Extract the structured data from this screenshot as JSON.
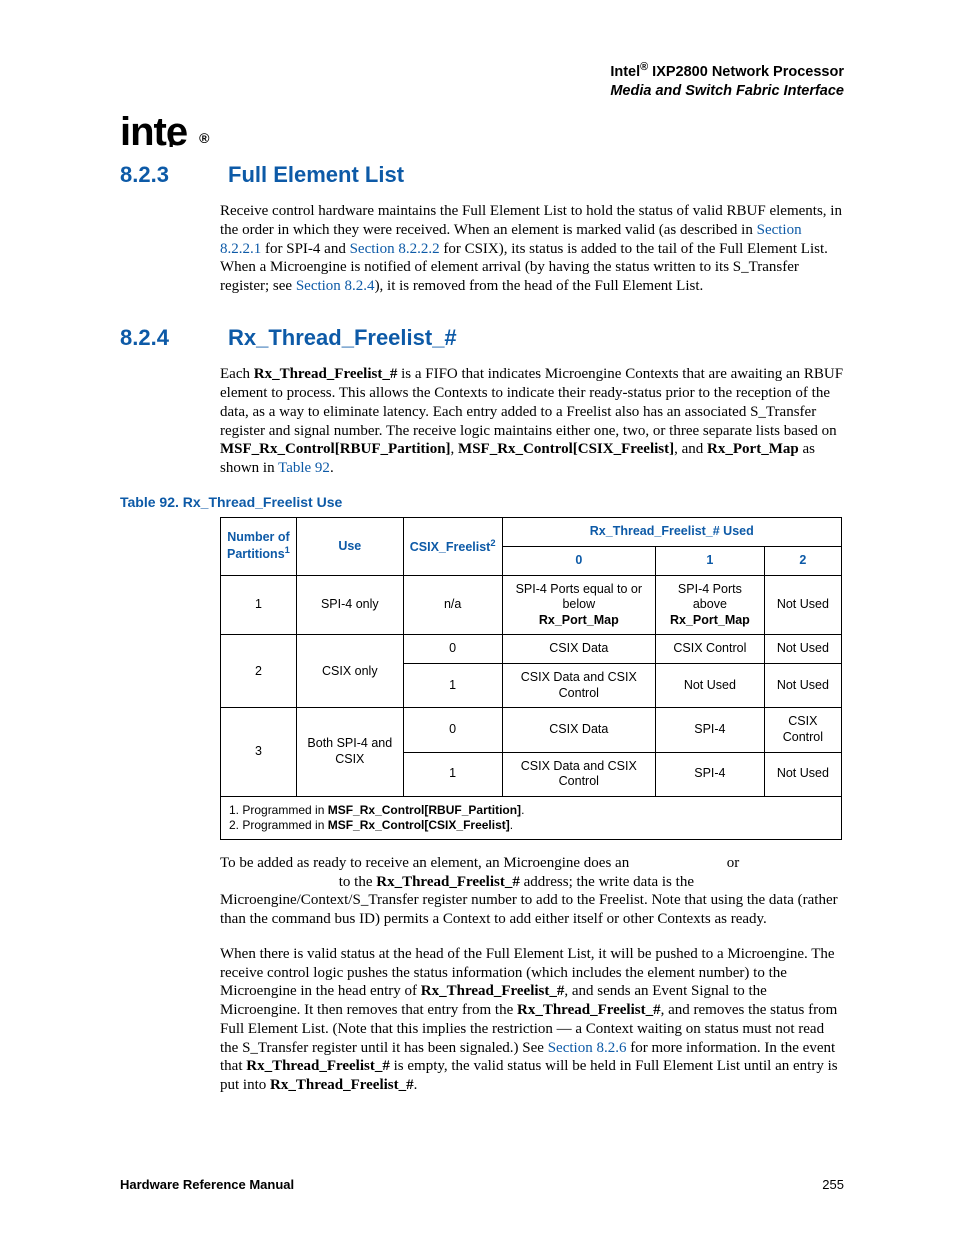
{
  "header": {
    "line1_pre": "Intel",
    "line1_post": " IXP2800 Network Processor",
    "line2": "Media and Switch Fabric Interface"
  },
  "logo": "intel",
  "sections": {
    "s823": {
      "num": "8.2.3",
      "title": "Full Element List"
    },
    "s824": {
      "num": "8.2.4",
      "title": "Rx_Thread_Freelist_#"
    }
  },
  "para823": {
    "t1": "Receive control hardware maintains the Full Element List to hold the status of valid RBUF elements, in the order in which they were received. When an element is marked valid (as described in ",
    "l1": "Section 8.2.2.1",
    "t2": " for SPI-4 and ",
    "l2": "Section 8.2.2.2",
    "t3": " for CSIX), its status is added to the tail of the Full Element List. When a Microengine is notified of element arrival (by having the status written to its S_Transfer register; see ",
    "l3": "Section 8.2.4",
    "t4": "), it is removed from the head of the Full Element List."
  },
  "para824a": {
    "t1": "Each ",
    "b1": "Rx_Thread_Freelist_#",
    "t2": " is a FIFO that indicates Microengine Contexts that are awaiting an RBUF element to process. This allows the Contexts to indicate their ready-status prior to the reception of the data, as a way to eliminate latency. Each entry added to a Freelist also has an associated S_Transfer register and signal number. The receive logic maintains either one, two, or three separate lists based on ",
    "b2": "MSF_Rx_Control[RBUF_Partition]",
    "t3": ", ",
    "b3": "MSF_Rx_Control[CSIX_Freelist]",
    "t4": ", and ",
    "b4": "Rx_Port_Map",
    "t5": " as shown in ",
    "l1": "Table 92",
    "t6": "."
  },
  "table": {
    "caption": "Table 92.  Rx_Thread_Freelist Use",
    "head": {
      "c1a": "Number of",
      "c1b": "Partitions",
      "c2": "Use",
      "c3": "CSIX_Freelist",
      "topspan": "Rx_Thread_Freelist_# Used",
      "s0": "0",
      "s1": "1",
      "s2": "2"
    },
    "rows": {
      "r1": {
        "p": "1",
        "use": "SPI-4 only",
        "cf": "n/a",
        "c0a": "SPI-4 Ports equal to or below",
        "c0b": "Rx_Port_Map",
        "c1a": "SPI-4 Ports above",
        "c1b": "Rx_Port_Map",
        "c2": "Not Used"
      },
      "r2": {
        "p": "2",
        "use": "CSIX only",
        "a": {
          "cf": "0",
          "c0": "CSIX Data",
          "c1": "CSIX Control",
          "c2": "Not Used"
        },
        "b": {
          "cf": "1",
          "c0": "CSIX Data and CSIX Control",
          "c1": "Not Used",
          "c2": "Not Used"
        }
      },
      "r3": {
        "p": "3",
        "use": "Both SPI-4 and CSIX",
        "a": {
          "cf": "0",
          "c0": "CSIX Data",
          "c1": "SPI-4",
          "c2": "CSIX Control"
        },
        "b": {
          "cf": "1",
          "c0": "CSIX Data and CSIX Control",
          "c1": "SPI-4",
          "c2": "Not Used"
        }
      }
    },
    "foot": {
      "f1a": "1. Programmed in ",
      "f1b": "MSF_Rx_Control[RBUF_Partition]",
      "f1c": ".",
      "f2a": "2. Programmed in ",
      "f2b": "MSF_Rx_Control[CSIX_Freelist]",
      "f2c": "."
    }
  },
  "para824b": {
    "t1": "To be added as ready to receive an element, an Microengine does an ",
    "t1gap": " or ",
    "t2": " to the ",
    "b1": "Rx_Thread_Freelist_#",
    "t3": " address; the write data is the Microengine/Context/S_Transfer register number to add to the Freelist. Note that using the data (rather than the command bus ID) permits a Context to add either itself or other Contexts as ready."
  },
  "para824c": {
    "t1": "When there is valid status at the head of the Full Element List, it will be pushed to a Microengine. The receive control logic pushes the status information (which includes the element number) to the Microengine in the head entry of ",
    "b1": "Rx_Thread_Freelist_#",
    "t2": ", and sends an Event Signal to the Microengine. It then removes that entry from the ",
    "b2": "Rx_Thread_Freelist_#",
    "t3": ", and removes the status from Full Element List. (Note that this implies the restriction — a Context waiting on status must not read the S_Transfer register until it has been signaled.) See ",
    "l1": "Section 8.2.6",
    "t4": " for more information. In the event that ",
    "b3": "Rx_Thread_Freelist_#",
    "t5": " is empty, the valid status will be held in Full Element List until an entry is put into ",
    "b4": "Rx_Thread_Freelist_#",
    "t6": "."
  },
  "footer": {
    "left": "Hardware Reference Manual",
    "right": "255"
  }
}
